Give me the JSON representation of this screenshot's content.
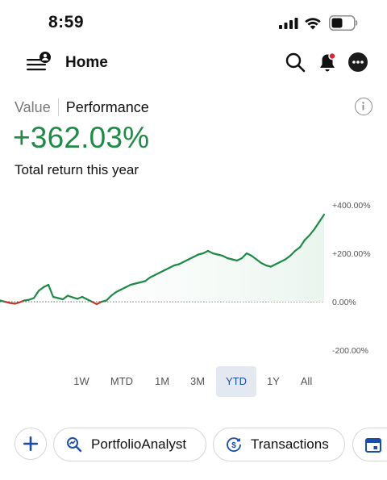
{
  "status_bar": {
    "time": "8:59"
  },
  "nav": {
    "title": "Home"
  },
  "toggle": {
    "value_label": "Value",
    "performance_label": "Performance"
  },
  "summary": {
    "return_value": "+362.03%",
    "return_label": "Total return this year"
  },
  "colors": {
    "positive": "#1f8a45",
    "negative": "#c0392b",
    "accent": "#1b4ea8",
    "fill": "#eaf5ee"
  },
  "chart_data": {
    "type": "line",
    "y_ticks": [
      "+400.00%",
      "+200.00%",
      "0.00%",
      "-200.00%"
    ],
    "ylim": [
      -200,
      400
    ],
    "baseline": 0,
    "grid": false,
    "x": [
      0,
      1,
      2,
      3,
      4,
      5,
      6,
      7,
      8,
      9,
      10,
      11,
      12,
      13,
      14,
      15,
      16,
      17,
      18,
      19,
      20,
      21,
      22,
      23,
      24,
      25,
      26,
      27,
      28,
      29,
      30,
      31,
      32,
      33,
      34,
      35,
      36,
      37,
      38,
      39,
      40,
      41,
      42,
      43,
      44,
      45,
      46,
      47,
      48,
      49,
      50,
      51,
      52,
      53,
      54,
      55,
      56,
      57,
      58,
      59,
      60,
      61,
      62,
      63,
      64,
      65,
      66,
      67
    ],
    "values": [
      5,
      0,
      -5,
      -8,
      -3,
      5,
      8,
      15,
      45,
      60,
      70,
      20,
      15,
      10,
      25,
      18,
      12,
      20,
      10,
      0,
      -10,
      0,
      5,
      25,
      40,
      50,
      60,
      70,
      75,
      80,
      85,
      100,
      110,
      120,
      130,
      140,
      150,
      155,
      165,
      175,
      185,
      195,
      200,
      210,
      200,
      195,
      190,
      180,
      175,
      170,
      180,
      200,
      190,
      175,
      160,
      150,
      145,
      155,
      165,
      175,
      190,
      210,
      225,
      255,
      275,
      300,
      330,
      360
    ]
  },
  "ranges": [
    {
      "label": "1W",
      "active": false
    },
    {
      "label": "MTD",
      "active": false
    },
    {
      "label": "1M",
      "active": false
    },
    {
      "label": "3M",
      "active": false
    },
    {
      "label": "YTD",
      "active": true
    },
    {
      "label": "1Y",
      "active": false
    },
    {
      "label": "All",
      "active": false
    }
  ],
  "actions": {
    "portfolio_label": "PortfolioAnalyst",
    "transactions_label": "Transactions"
  },
  "icons": [
    "menu-icon",
    "profile-badge-icon",
    "search-icon",
    "bell-icon",
    "more-icon",
    "info-icon",
    "plus-icon",
    "portfolio-analyst-icon",
    "transactions-icon",
    "calendar-icon"
  ]
}
